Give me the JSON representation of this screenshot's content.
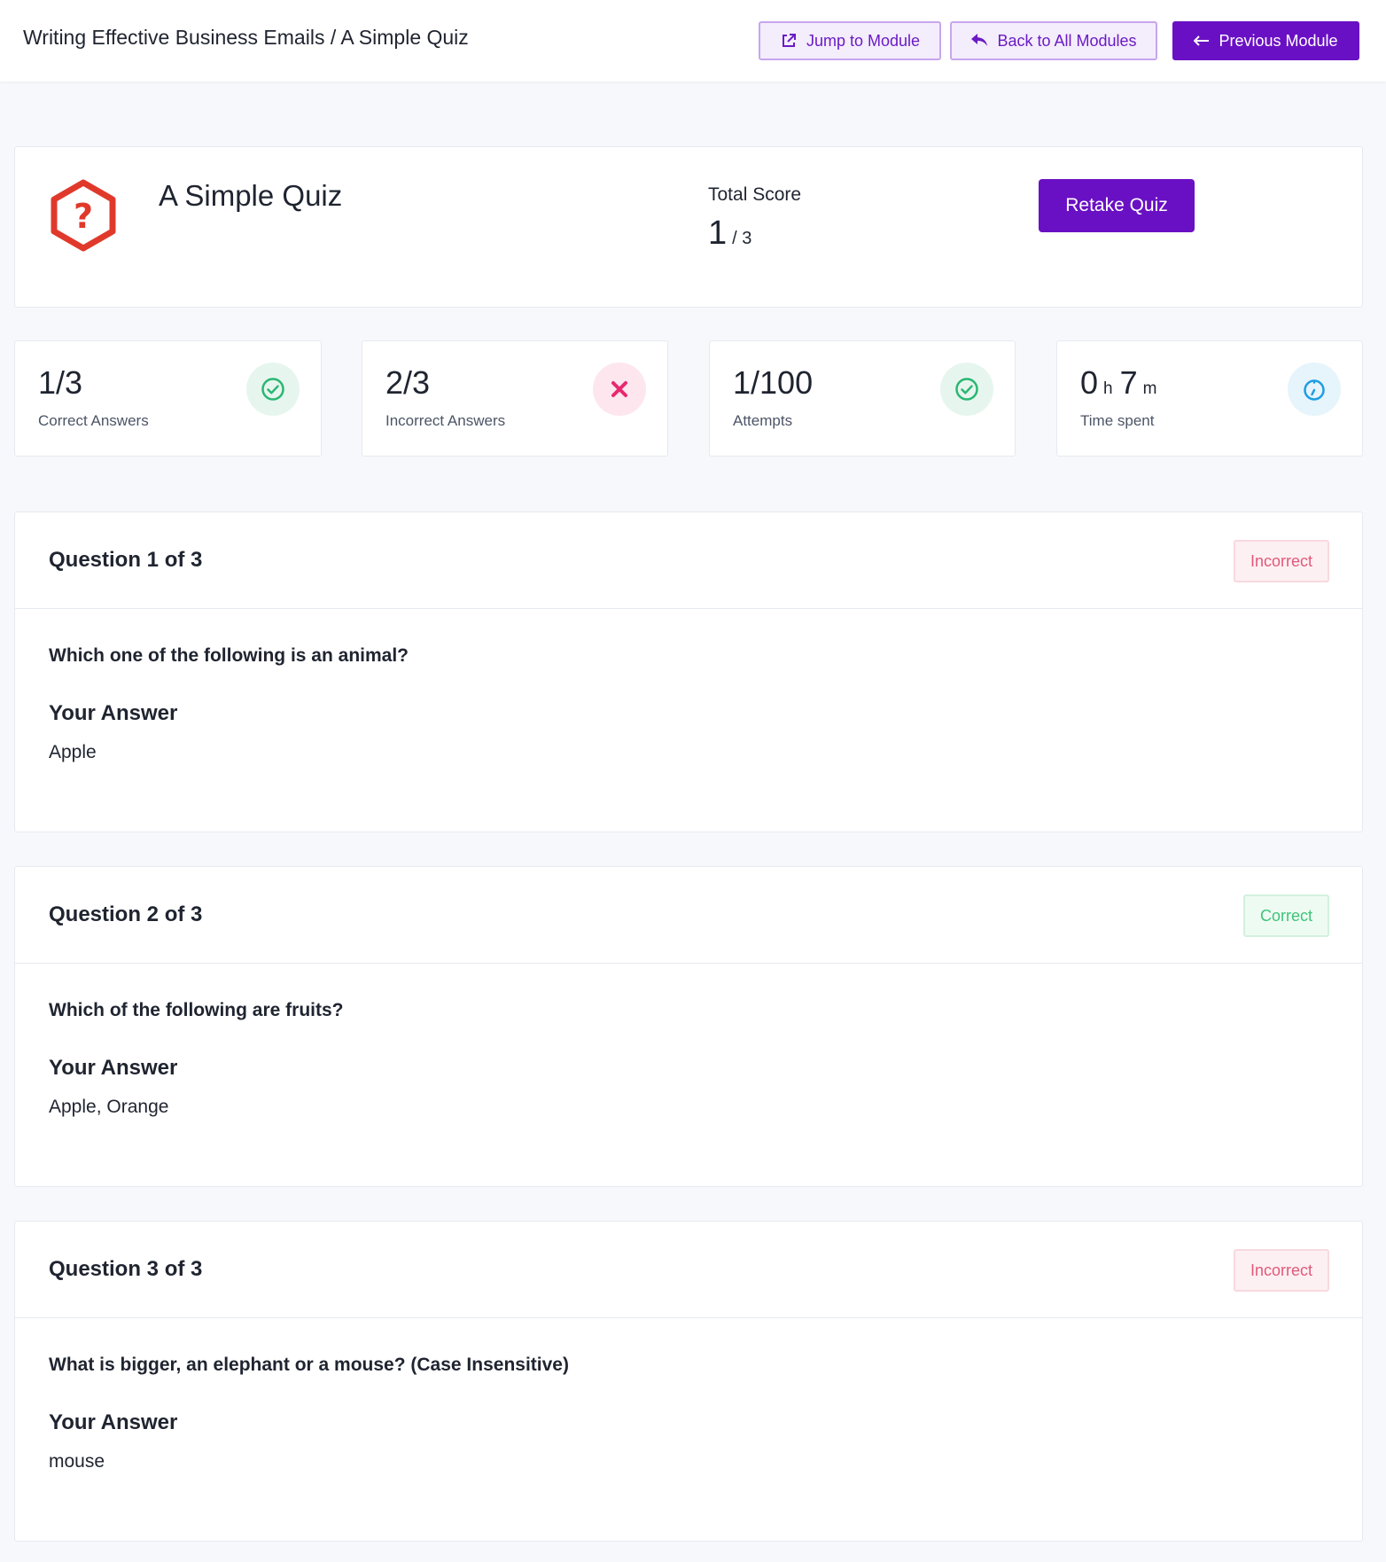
{
  "header": {
    "breadcrumb": "Writing Effective Business Emails / A Simple Quiz",
    "jump_label": "Jump to Module",
    "back_label": "Back to All Modules",
    "previous_label": "Previous Module"
  },
  "quiz": {
    "title": "A Simple Quiz",
    "score_label": "Total Score",
    "score_value": "1",
    "score_total": "/ 3",
    "retake_label": "Retake Quiz"
  },
  "stats": {
    "correct": {
      "value": "1/3",
      "label": "Correct Answers",
      "icon": "check-circle-icon"
    },
    "incorrect": {
      "value": "2/3",
      "label": "Incorrect Answers",
      "icon": "close-icon"
    },
    "attempts": {
      "value": "1/100",
      "label": "Attempts",
      "icon": "check-circle-icon"
    },
    "time": {
      "hours": "0",
      "hours_unit": "h",
      "minutes": "7",
      "minutes_unit": "m",
      "label": "Time spent",
      "icon": "stopwatch-icon"
    }
  },
  "questions": [
    {
      "title": "Question 1 of 3",
      "status": "Incorrect",
      "text": "Which one of the following is an animal?",
      "answer_label": "Your Answer",
      "answer": "Apple"
    },
    {
      "title": "Question 2 of 3",
      "status": "Correct",
      "text": "Which of the following are fruits?",
      "answer_label": "Your Answer",
      "answer": "Apple, Orange"
    },
    {
      "title": "Question 3 of 3",
      "status": "Incorrect",
      "text": "What is bigger, an elephant or a mouse? (Case Insensitive)",
      "answer_label": "Your Answer",
      "answer": "mouse"
    }
  ],
  "colors": {
    "primary": "#6a10c4",
    "success": "#2bb673",
    "danger": "#e8286f",
    "info": "#1e9de3",
    "quiz_icon": "#e0392b"
  }
}
